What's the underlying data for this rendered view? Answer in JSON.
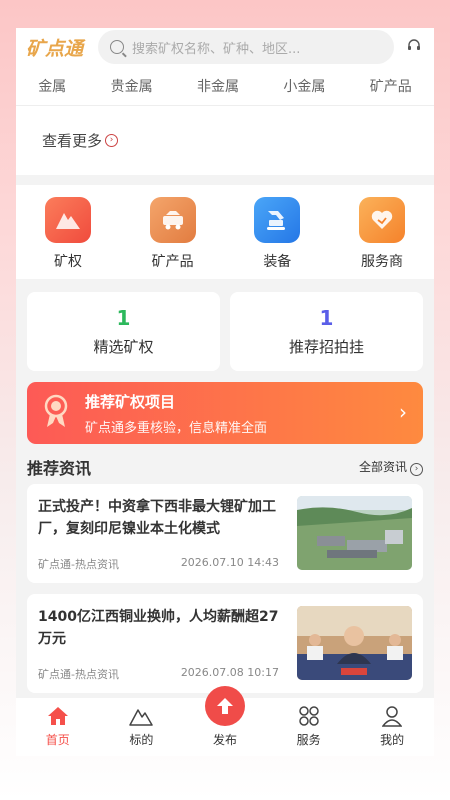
{
  "header": {
    "logo": "矿点通",
    "search_placeholder": "搜索矿权名称、矿种、地区..."
  },
  "categories": [
    "金属",
    "贵金属",
    "非金属",
    "小金属",
    "矿产品"
  ],
  "more_label": "查看更多",
  "quick_icons": [
    {
      "label": "矿权",
      "icon": "mountain-icon",
      "color": "#f45e48"
    },
    {
      "label": "矿产品",
      "icon": "cart-icon",
      "color": "#e98a4a"
    },
    {
      "label": "装备",
      "icon": "excavator-icon",
      "color": "#2f8bf0"
    },
    {
      "label": "服务商",
      "icon": "heart-hands-icon",
      "color": "#f79a3c"
    }
  ],
  "stats": [
    {
      "value": "1",
      "label": "精选矿权",
      "color": "#2cb85c"
    },
    {
      "value": "1",
      "label": "推荐招拍挂",
      "color": "#5a5ee8"
    }
  ],
  "banner": {
    "title": "推荐矿权项目",
    "subtitle": "矿点通多重核验，信息精准全面"
  },
  "news_section": {
    "title": "推荐资讯",
    "all_label": "全部资讯"
  },
  "news": [
    {
      "headline": "正式投产！中资拿下西非最大锂矿加工厂，复刻印尼镍业本土化模式",
      "source": "矿点通-热点资讯",
      "time": "2026.07.10 14:43"
    },
    {
      "headline": "1400亿江西铜业换帅，人均薪酬超27万元",
      "source": "矿点通-热点资讯",
      "time": "2026.07.08 10:17"
    }
  ],
  "tabs": [
    {
      "label": "首页",
      "icon": "home-icon",
      "active": true
    },
    {
      "label": "标的",
      "icon": "mountain-outline-icon"
    },
    {
      "label": "发布",
      "icon": "upload-icon"
    },
    {
      "label": "服务",
      "icon": "grid-icon"
    },
    {
      "label": "我的",
      "icon": "user-icon"
    }
  ]
}
